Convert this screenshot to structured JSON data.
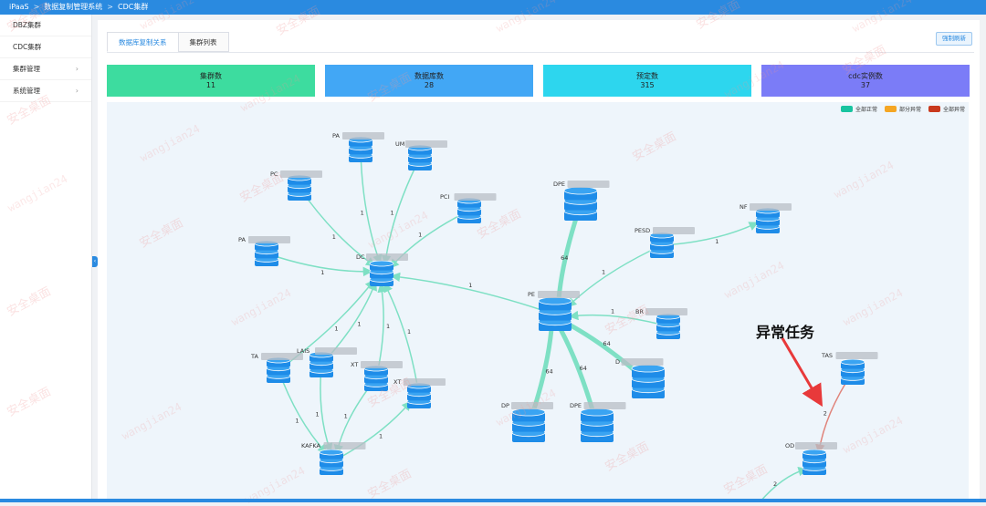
{
  "breadcrumb": [
    "iPaaS",
    "数据复制管理系统",
    "CDC集群"
  ],
  "sidebar": {
    "items": [
      {
        "label": "DBZ集群",
        "chevron": false
      },
      {
        "label": "CDC集群",
        "chevron": false
      },
      {
        "label": "集群管理",
        "chevron": true
      },
      {
        "label": "系统管理",
        "chevron": true
      }
    ]
  },
  "tabs": [
    {
      "label": "数据库复制关系",
      "active": true
    },
    {
      "label": "集群列表",
      "active": false
    }
  ],
  "refresh_label": "强制刷新",
  "stats": [
    {
      "label": "集群数",
      "value": "11",
      "color": "#3ddc9f"
    },
    {
      "label": "数据库数",
      "value": "28",
      "color": "#42a7f5"
    },
    {
      "label": "预定数",
      "value": "315",
      "color": "#2dd6ee"
    },
    {
      "label": "cdc实例数",
      "value": "37",
      "color": "#7b7cf7"
    }
  ],
  "legend": [
    {
      "label": "全部正常",
      "color": "#18c4a0"
    },
    {
      "label": "部分异常",
      "color": "#f5a623"
    },
    {
      "label": "全部异常",
      "color": "#c9391e"
    }
  ],
  "colors": {
    "node": "#1e8ce8",
    "edge_ok": "#7ee0c4",
    "edge_err": "#e0837a",
    "arrow": "#e8393a"
  },
  "graph": {
    "nodes": [
      {
        "id": "pa1",
        "label": "PA"
      },
      {
        "id": "um",
        "label": "UM"
      },
      {
        "id": "pc1",
        "label": "PC"
      },
      {
        "id": "pc2",
        "label": "PCI"
      },
      {
        "id": "pa2",
        "label": "PA"
      },
      {
        "id": "dc",
        "label": "DC"
      },
      {
        "id": "dpe_top",
        "label": "DPE"
      },
      {
        "id": "pesd",
        "label": "PESD"
      },
      {
        "id": "nf",
        "label": "NF"
      },
      {
        "id": "pe",
        "label": "PE"
      },
      {
        "id": "br",
        "label": "BR"
      },
      {
        "id": "ta",
        "label": "TA"
      },
      {
        "id": "lais",
        "label": "LAIS"
      },
      {
        "id": "xt1",
        "label": "XT"
      },
      {
        "id": "xt2",
        "label": "XT"
      },
      {
        "id": "kafka",
        "label": "KAFKA"
      },
      {
        "id": "dp1",
        "label": "DP"
      },
      {
        "id": "dpe2",
        "label": "DPE"
      },
      {
        "id": "d",
        "label": "D"
      },
      {
        "id": "tas",
        "label": "TAS"
      },
      {
        "id": "od",
        "label": "OD"
      }
    ],
    "edges": [
      {
        "from": "pa1",
        "to": "dc",
        "label": "1"
      },
      {
        "from": "um",
        "to": "dc",
        "label": "1"
      },
      {
        "from": "pc1",
        "to": "dc",
        "label": "1"
      },
      {
        "from": "pc2",
        "to": "dc",
        "label": "1"
      },
      {
        "from": "pa2",
        "to": "dc",
        "label": "1"
      },
      {
        "from": "pe",
        "to": "dc",
        "label": "1"
      },
      {
        "from": "dpe_top",
        "to": "pe",
        "label": "64"
      },
      {
        "from": "pesd",
        "to": "nf",
        "label": "1"
      },
      {
        "from": "pesd",
        "to": "pe",
        "label": "1"
      },
      {
        "from": "br",
        "to": "pe",
        "label": "1"
      },
      {
        "from": "dp1",
        "to": "pe",
        "label": "64"
      },
      {
        "from": "dpe2",
        "to": "pe",
        "label": "64"
      },
      {
        "from": "d",
        "to": "pe",
        "label": "64"
      },
      {
        "from": "ta",
        "to": "dc",
        "label": "1"
      },
      {
        "from": "lais",
        "to": "dc",
        "label": "1"
      },
      {
        "from": "xt1",
        "to": "dc",
        "label": "1"
      },
      {
        "from": "xt2",
        "to": "dc",
        "label": "1"
      },
      {
        "from": "ta",
        "to": "kafka",
        "label": "1"
      },
      {
        "from": "lais",
        "to": "kafka",
        "label": "1"
      },
      {
        "from": "xt1",
        "to": "kafka",
        "label": "1"
      },
      {
        "from": "kafka",
        "to": "xt2",
        "label": "1"
      },
      {
        "from": "tas",
        "to": "od",
        "label": "2",
        "status": "error"
      },
      {
        "label": "2"
      }
    ]
  },
  "annotation": "异常任务",
  "watermark": {
    "text_cn": "安全桌面",
    "text_en": "wangjian24"
  }
}
